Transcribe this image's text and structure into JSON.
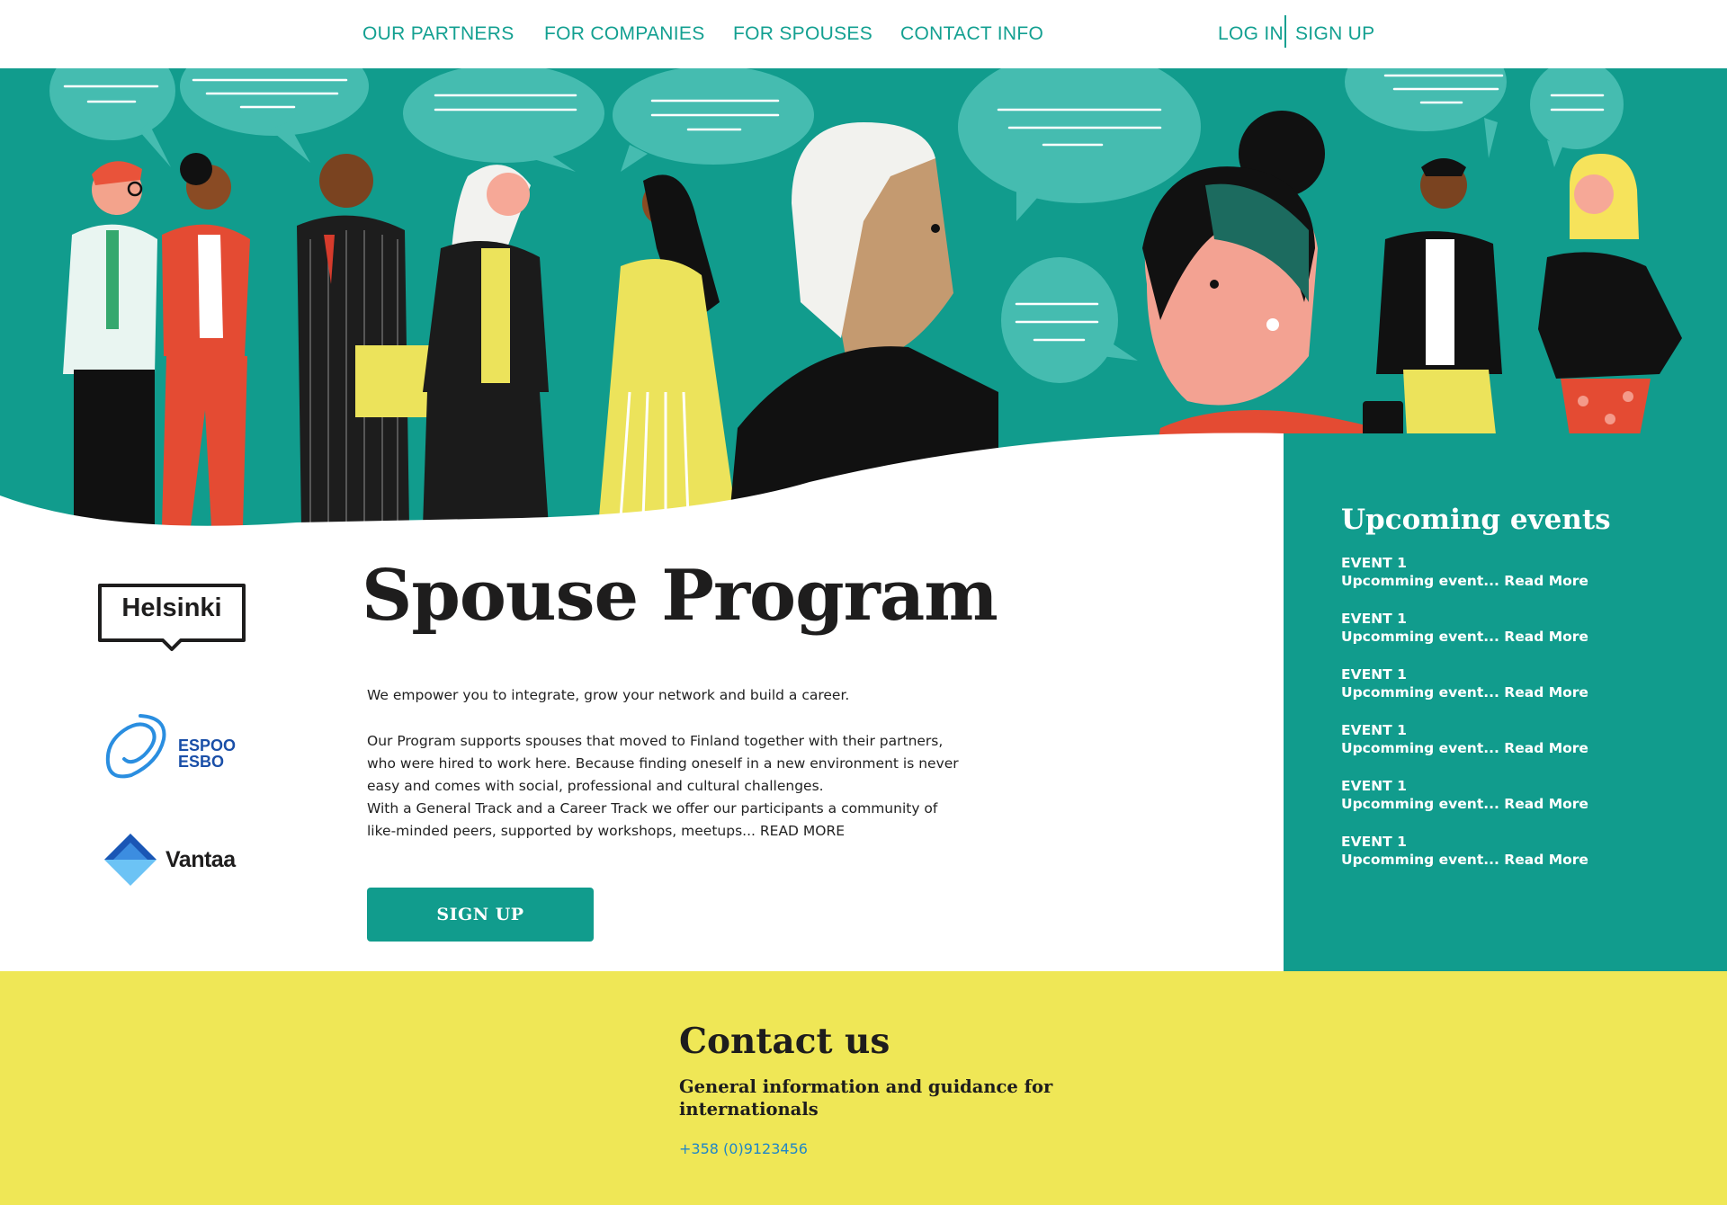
{
  "nav": {
    "links": [
      "OUR PARTNERS",
      "FOR COMPANIES",
      "FOR SPOUSES",
      "CONTACT INFO"
    ],
    "login": "LOG IN",
    "signup": "SIGN UP"
  },
  "partners": {
    "helsinki": "Helsinki",
    "espoo_line1": "ESPOO",
    "espoo_line2": "ESBO",
    "vantaa": "Vantaa"
  },
  "main": {
    "title": "Spouse Program",
    "intro": "We empower you to integrate, grow your network and build a career.",
    "paragraph1": "Our Program supports spouses that moved to Finland together with their partners, who were hired to work here. Because finding oneself in a new environment is never easy and comes with social, professional and cultural challenges.",
    "paragraph2": "With a General Track and a Career Track we offer our participants a community of like-minded peers, supported by workshops, meetups...",
    "read_more": "READ MORE",
    "signup_button": "SIGN UP"
  },
  "events": {
    "title": "Upcoming events",
    "items": [
      {
        "name": "EVENT 1",
        "desc": "Upcomming event... Read More"
      },
      {
        "name": "EVENT 1",
        "desc": "Upcomming event... Read More"
      },
      {
        "name": "EVENT 1",
        "desc": "Upcomming event... Read More"
      },
      {
        "name": "EVENT 1",
        "desc": "Upcomming event... Read More"
      },
      {
        "name": "EVENT 1",
        "desc": "Upcomming event... Read More"
      },
      {
        "name": "EVENT 1",
        "desc": "Upcomming event... Read More"
      }
    ]
  },
  "contact": {
    "title": "Contact us",
    "subtitle": "General information and guidance for internationals",
    "phone": "+358 (0)9123456"
  },
  "colors": {
    "teal": "#119c8d",
    "nav_text": "#13a091",
    "yellow": "#efe756",
    "link_blue": "#1f86c7"
  },
  "icons": {
    "helsinki_logo": "helsinki-logo",
    "espoo_logo": "espoo-logo",
    "vantaa_logo": "vantaa-logo",
    "hero_illustration": "people-talking-illustration"
  }
}
